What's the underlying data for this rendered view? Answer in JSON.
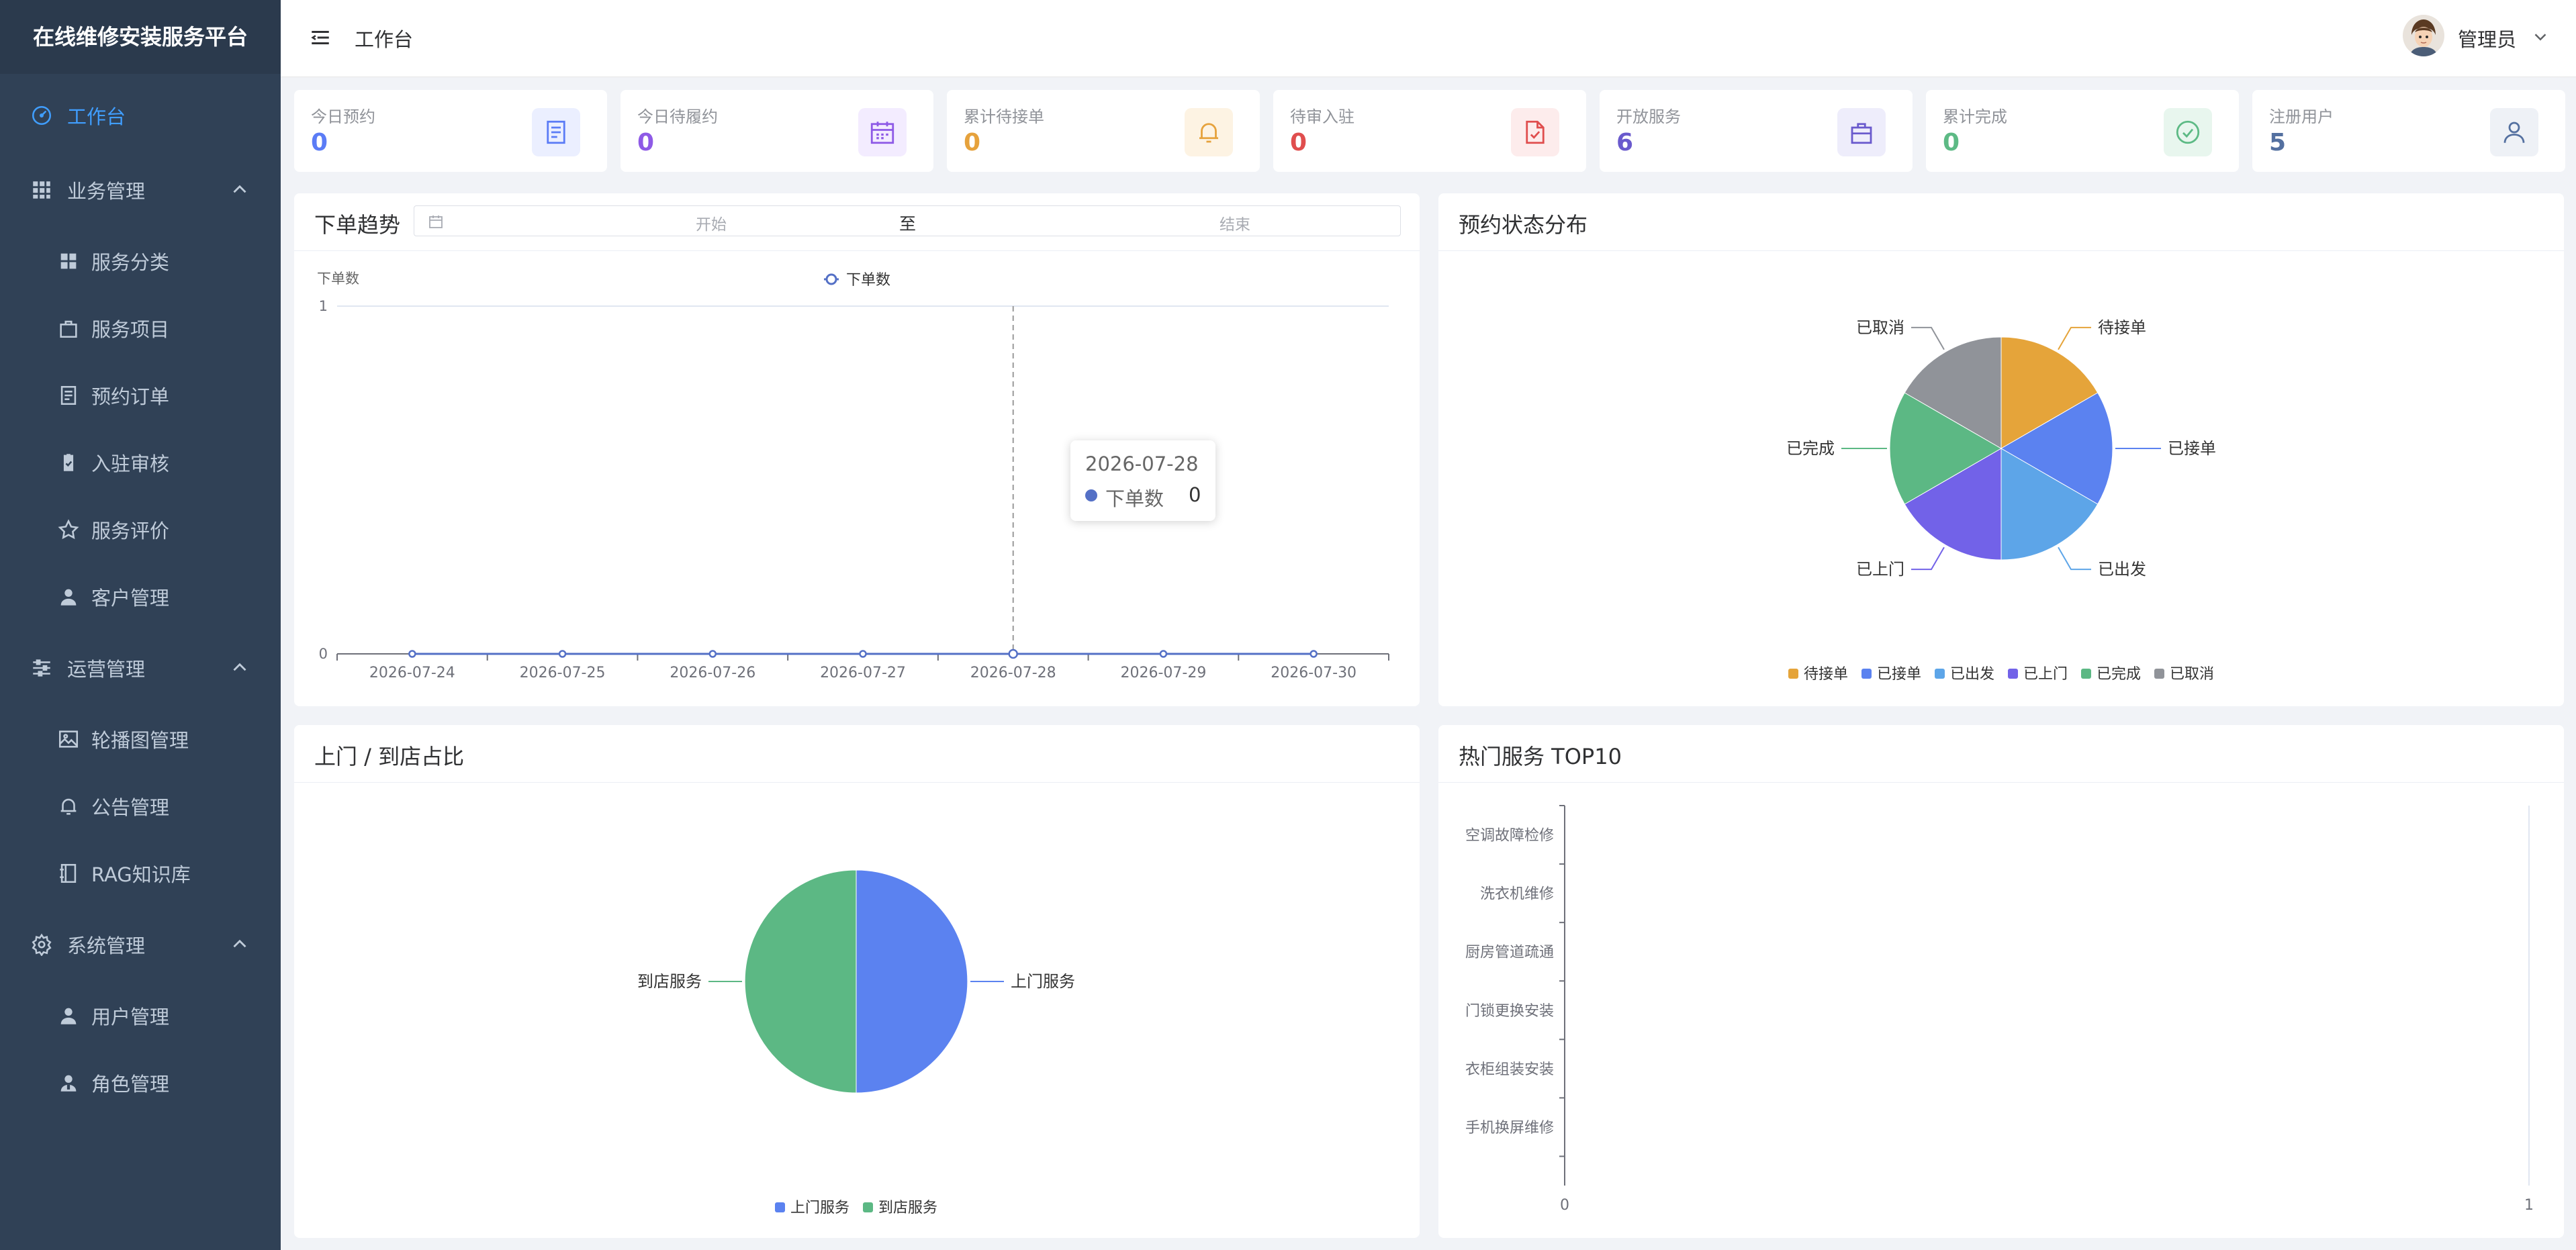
{
  "app": {
    "title": "在线维修安装服务平台",
    "accent_color": "#409eff"
  },
  "sidebar": {
    "items": [
      {
        "label": "工作台",
        "icon": "dashboard-icon"
      },
      {
        "label": "业务管理",
        "icon": "grid-icon"
      },
      {
        "label": "服务分类",
        "icon": "category-icon"
      },
      {
        "label": "服务项目",
        "icon": "bag-icon"
      },
      {
        "label": "预约订单",
        "icon": "document-icon"
      },
      {
        "label": "入驻审核",
        "icon": "clipboard-icon"
      },
      {
        "label": "服务评价",
        "icon": "star-icon"
      },
      {
        "label": "客户管理",
        "icon": "user-icon"
      },
      {
        "label": "运营管理",
        "icon": "sliders-icon"
      },
      {
        "label": "轮播图管理",
        "icon": "picture-icon"
      },
      {
        "label": "公告管理",
        "icon": "bell-icon"
      },
      {
        "label": "RAG知识库",
        "icon": "notebook-icon"
      },
      {
        "label": "系统管理",
        "icon": "gear-icon"
      },
      {
        "label": "用户管理",
        "icon": "user-icon"
      },
      {
        "label": "角色管理",
        "icon": "user-role-icon"
      }
    ]
  },
  "header": {
    "breadcrumb": "工作台",
    "username": "管理员"
  },
  "stats": [
    {
      "label": "今日预约",
      "value": "0",
      "color": "#5b7cf6",
      "icon": "document-icon"
    },
    {
      "label": "今日待履约",
      "value": "0",
      "color": "#8e5ae6",
      "icon": "calendar-icon"
    },
    {
      "label": "累计待接单",
      "value": "0",
      "color": "#e6a23c",
      "icon": "bell-icon"
    },
    {
      "label": "待审入驻",
      "value": "0",
      "color": "#e04e4e",
      "icon": "document-check-icon"
    },
    {
      "label": "开放服务",
      "value": "6",
      "color": "#6a5acd",
      "icon": "bag-icon"
    },
    {
      "label": "累计完成",
      "value": "0",
      "color": "#5dba85",
      "icon": "check-circle-icon"
    },
    {
      "label": "注册用户",
      "value": "5",
      "color": "#5470a0",
      "icon": "user-icon"
    }
  ],
  "trend": {
    "title": "下单趋势",
    "range_start_placeholder": "开始",
    "range_separator": "至",
    "range_end_placeholder": "结束",
    "tooltip": {
      "date": "2026-07-28",
      "series": "下单数",
      "value": "0"
    }
  },
  "status_panel": {
    "title": "预约状态分布"
  },
  "visit_panel": {
    "title": "上门 / 到店占比"
  },
  "top_panel": {
    "title": "热门服务 TOP10"
  },
  "chart_data": [
    {
      "type": "line",
      "ylabel": "下单数",
      "x": [
        "2026-07-24",
        "2026-07-25",
        "2026-07-26",
        "2026-07-27",
        "2026-07-28",
        "2026-07-29",
        "2026-07-30"
      ],
      "ylim": [
        0,
        1
      ],
      "y_ticks": [
        "0",
        "1"
      ],
      "series": [
        {
          "name": "下单数",
          "values": [
            0,
            0,
            0,
            0,
            0,
            0,
            0
          ],
          "color": "#5470c6"
        }
      ],
      "legend": "top-center",
      "grid": true
    },
    {
      "type": "pie",
      "slices": [
        {
          "label": "待接单",
          "value": 1,
          "color": "#e5a43a"
        },
        {
          "label": "已接单",
          "value": 1,
          "color": "#5b82f0"
        },
        {
          "label": "已出发",
          "value": 1,
          "color": "#5da5e8"
        },
        {
          "label": "已上门",
          "value": 1,
          "color": "#7262e8"
        },
        {
          "label": "已完成",
          "value": 1,
          "color": "#5cb884"
        },
        {
          "label": "已取消",
          "value": 1,
          "color": "#909399"
        }
      ],
      "legend": "bottom-center"
    },
    {
      "type": "pie",
      "slices": [
        {
          "label": "上门服务",
          "value": 1,
          "color": "#5b82f0"
        },
        {
          "label": "到店服务",
          "value": 1,
          "color": "#5cb884"
        }
      ],
      "legend": "bottom-center"
    },
    {
      "type": "bar",
      "orientation": "horizontal",
      "categories": [
        "空调故障检修",
        "洗衣机维修",
        "厨房管道疏通",
        "门锁更换安装",
        "衣柜组装安装",
        "手机换屏维修"
      ],
      "values": [
        0,
        0,
        0,
        0,
        0,
        0
      ],
      "xlim": [
        0,
        1
      ],
      "x_ticks": [
        "0",
        "1"
      ]
    }
  ]
}
